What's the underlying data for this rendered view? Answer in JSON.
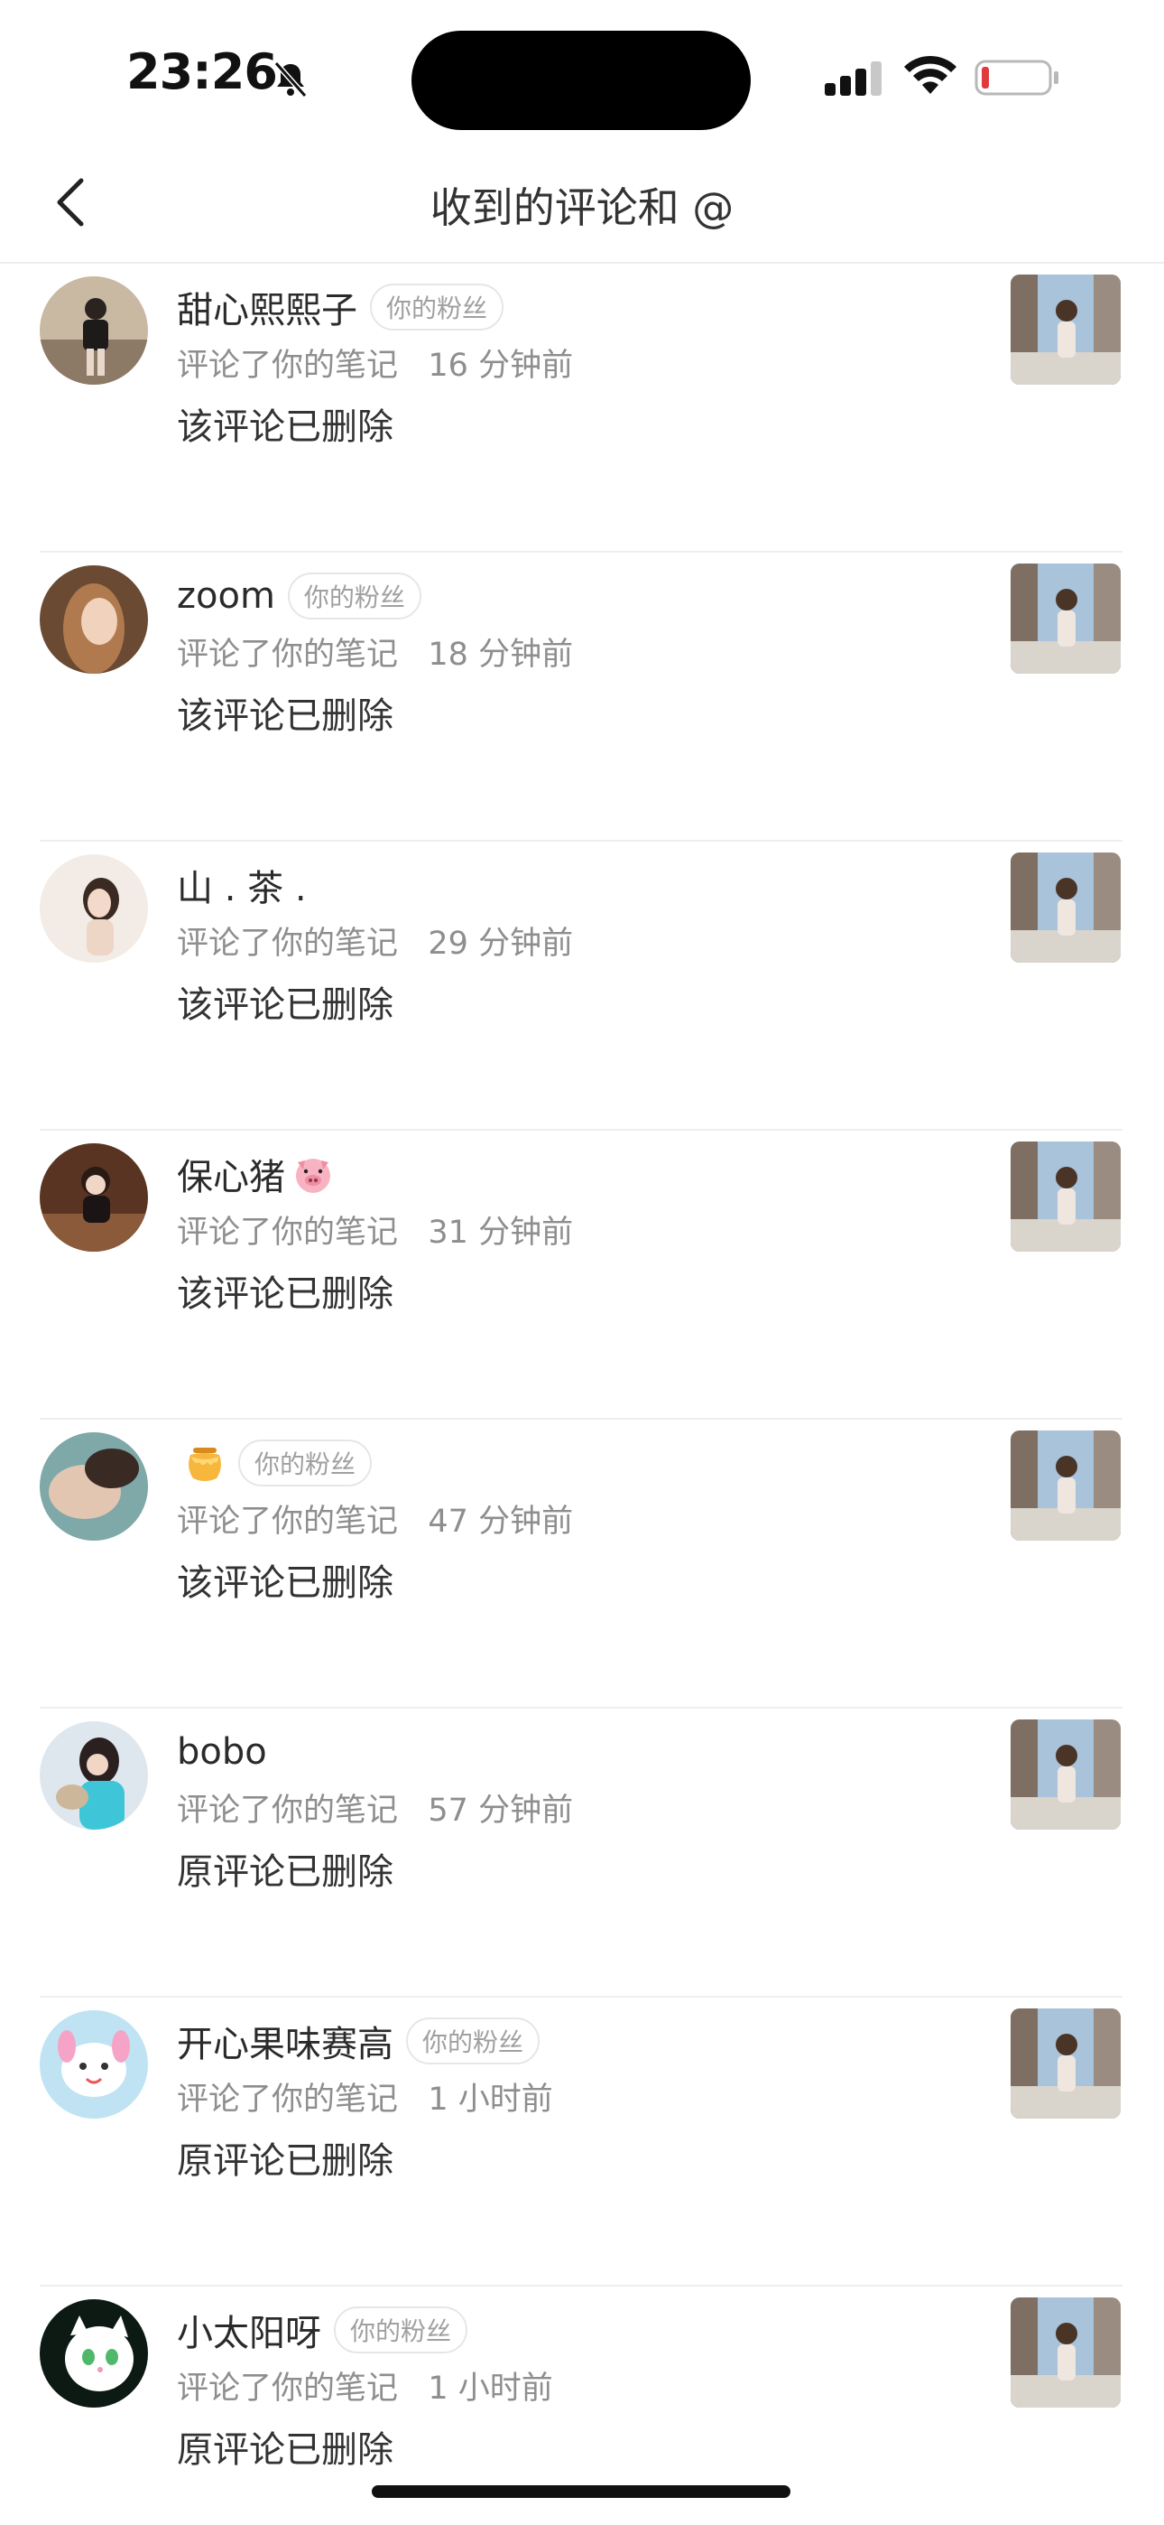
{
  "status_bar": {
    "time": "23:26",
    "icons": [
      "bell-slash-icon",
      "cellular-signal-icon",
      "wifi-icon",
      "battery-low-icon"
    ]
  },
  "nav": {
    "back_icon": "chevron-left-icon",
    "title": "收到的评论和 @"
  },
  "colors": {
    "meta_text": "#8e8e8e",
    "badge_border": "#e6e6e6",
    "divider": "#eeeeee",
    "battery_low": "#e0393e"
  },
  "notifications": [
    {
      "name": "甜心熙熙子",
      "badge": "你的粉丝",
      "action": "评论了你的笔记",
      "time": "16 分钟前",
      "comment": "该评论已删除"
    },
    {
      "name": "zoom",
      "badge": "你的粉丝",
      "action": "评论了你的笔记",
      "time": "18 分钟前",
      "comment": "该评论已删除"
    },
    {
      "name": "山 . 茶 .",
      "badge": "",
      "action": "评论了你的笔记",
      "time": "29 分钟前",
      "comment": "该评论已删除"
    },
    {
      "name": "保心猪",
      "name_emoji": "pig-face-emoji",
      "badge": "",
      "action": "评论了你的笔记",
      "time": "31 分钟前",
      "comment": "该评论已删除"
    },
    {
      "name": "",
      "name_emoji": "honey-pot-emoji",
      "badge": "你的粉丝",
      "action": "评论了你的笔记",
      "time": "47 分钟前",
      "comment": "该评论已删除"
    },
    {
      "name": "bobo",
      "badge": "",
      "action": "评论了你的笔记",
      "time": "57 分钟前",
      "comment": "原评论已删除"
    },
    {
      "name": "开心果味赛高",
      "badge": "你的粉丝",
      "action": "评论了你的笔记",
      "time": "1 小时前",
      "comment": "原评论已删除"
    },
    {
      "name": "小太阳呀",
      "badge": "你的粉丝",
      "action": "评论了你的笔记",
      "time": "1 小时前",
      "comment": "原评论已删除"
    }
  ]
}
